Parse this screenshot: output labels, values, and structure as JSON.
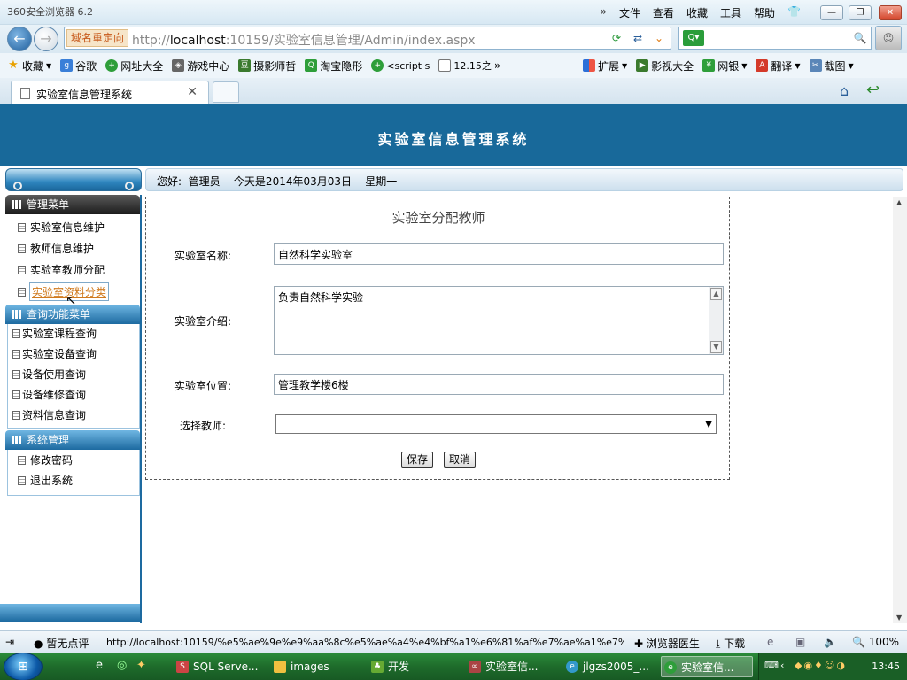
{
  "browser": {
    "app_title": "360安全浏览器 6.2",
    "menu": [
      "文件",
      "查看",
      "收藏",
      "工具",
      "帮助"
    ],
    "redirect_label": "域名重定向",
    "url_prefix": "http://",
    "url_host": "localhost",
    "url_rest": ":10159/实验室信息管理/Admin/index.aspx",
    "search_placeholder": "",
    "favorites": [
      "收藏",
      "谷歌",
      "网址大全",
      "游戏中心",
      "摄影师哲",
      "淘宝隐形",
      "<script s",
      "12.15之"
    ],
    "favorites_right": [
      "扩展",
      "影视大全",
      "网银",
      "翻译",
      "截图"
    ],
    "tab_title": "实验室信息管理系统"
  },
  "page": {
    "banner_title": "实验室信息管理系统",
    "greeting": "您好:  管理员    今天是2014年03月03日    星期一"
  },
  "sidebar": {
    "group1_title": "管理菜单",
    "group1_items": [
      "实验室信息维护",
      "教师信息维护",
      "实验室教师分配",
      "实验室资料分类"
    ],
    "group2_title": "查询功能菜单",
    "group2_items": [
      "实验室课程查询",
      "实验室设备查询",
      "设备使用查询",
      "设备维修查询",
      "资料信息查询"
    ],
    "group3_title": "系统管理",
    "group3_items": [
      "修改密码",
      "退出系统"
    ]
  },
  "form": {
    "title": "实验室分配教师",
    "name_label": "实验室名称:",
    "name_value": "自然科学实验室",
    "intro_label": "实验室介绍:",
    "intro_value": "负责自然科学实验",
    "location_label": "实验室位置:",
    "location_value": "管理教学楼6楼",
    "teacher_label": "选择教师:",
    "teacher_value": "",
    "save_label": "保存",
    "cancel_label": "取消"
  },
  "status": {
    "rating": "暂无点评",
    "link_url": "http://localhost:10159/%e5%ae%9e%e9%aa%8c%e5%ae%a4%e4%bf%a1%e6%81%af%e7%ae%a1%e7%90%86",
    "doctor": "浏览器医生",
    "download": "下载",
    "zoom": "100%"
  },
  "taskbar": {
    "items": [
      "SQL Serve...",
      "images",
      "开发",
      "实验室信...",
      "jlgzs2005_...",
      "实验室信..."
    ],
    "clock": "13:45"
  }
}
